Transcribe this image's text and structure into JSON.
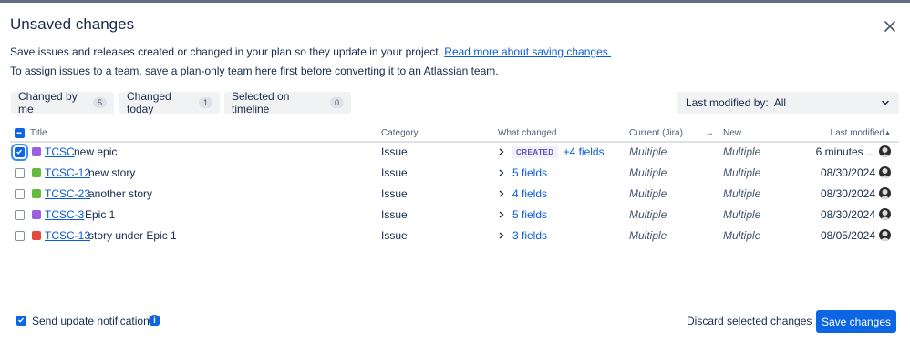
{
  "dialog": {
    "title": "Unsaved changes",
    "intro_text": "Save issues and releases created or changed in your plan so they update in your project. ",
    "intro_link": "Read more about saving changes.",
    "intro_text2": "To assign issues to a team, save a plan-only team here first before converting it to an Atlassian team."
  },
  "filters": [
    {
      "label": "Changed by me",
      "count": "5"
    },
    {
      "label": "Changed today",
      "count": "1"
    },
    {
      "label": "Selected on timeline",
      "count": "0"
    }
  ],
  "last_modified_filter": {
    "label": "Last modified by:",
    "value": "All"
  },
  "table": {
    "headers": {
      "title": "Title",
      "category": "Category",
      "what_changed": "What changed",
      "current": "Current (Jira)",
      "arrow": "→",
      "new": "New",
      "last_modified": "Last modified",
      "sort_indicator": "▴"
    },
    "rows": [
      {
        "type": "epic",
        "type_color": "#9f5ee0",
        "key": "TCSC",
        "summary": "new epic",
        "category": "Issue",
        "badge": "CREATED",
        "fields": "+4 fields",
        "current": "Multiple",
        "new": "Multiple",
        "last_modified": "6 minutes ...",
        "checked": true
      },
      {
        "type": "story",
        "type_color": "#63ba3c",
        "key": "TCSC-12",
        "summary": "new story",
        "category": "Issue",
        "badge": "",
        "fields": "5 fields",
        "current": "Multiple",
        "new": "Multiple",
        "last_modified": "08/30/2024",
        "checked": false
      },
      {
        "type": "story",
        "type_color": "#63ba3c",
        "key": "TCSC-23",
        "summary": "another story",
        "category": "Issue",
        "badge": "",
        "fields": "4 fields",
        "current": "Multiple",
        "new": "Multiple",
        "last_modified": "08/30/2024",
        "checked": false
      },
      {
        "type": "epic",
        "type_color": "#9f5ee0",
        "key": "TCSC-3",
        "summary": "Epic 1",
        "category": "Issue",
        "badge": "",
        "fields": "5 fields",
        "current": "Multiple",
        "new": "Multiple",
        "last_modified": "08/30/2024",
        "checked": false
      },
      {
        "type": "bug",
        "type_color": "#e5493a",
        "key": "TCSC-13",
        "summary": "story under Epic 1",
        "category": "Issue",
        "badge": "",
        "fields": "3 fields",
        "current": "Multiple",
        "new": "Multiple",
        "last_modified": "08/05/2024",
        "checked": false
      }
    ]
  },
  "footer": {
    "notify_label": "Send update notifications",
    "notify_checked": true,
    "discard_label": "Discard selected changes",
    "save_label": "Save changes"
  },
  "colors": {
    "primary": "#0c66e4",
    "link": "#0b5bd7",
    "text": "#172b4d"
  }
}
